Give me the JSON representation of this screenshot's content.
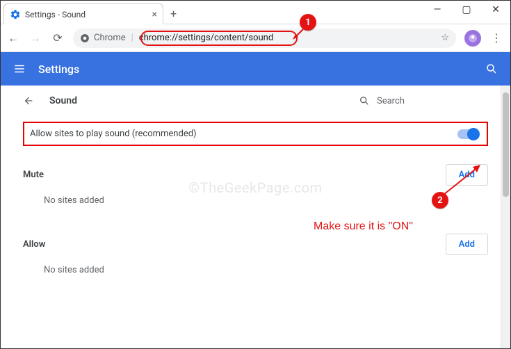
{
  "window": {
    "tab_title": "Settings - Sound",
    "minimize": "—",
    "maximize": "▢",
    "close": "✕",
    "new_tab": "+"
  },
  "addr": {
    "back": "←",
    "forward": "→",
    "reload": "⟳",
    "chip_label": "Chrome",
    "url": "chrome://settings/content/sound",
    "star": "☆",
    "menu": "⋮"
  },
  "bluebar": {
    "title": "Settings"
  },
  "page": {
    "back_arrow": "←",
    "title": "Sound",
    "search_placeholder": "Search",
    "allow_label": "Allow sites to play sound (recommended)",
    "toggle_on": true,
    "sections": {
      "mute": {
        "title": "Mute",
        "add": "Add",
        "empty": "No sites added"
      },
      "allow": {
        "title": "Allow",
        "add": "Add",
        "empty": "No sites added"
      }
    }
  },
  "annotations": {
    "circle1": "1",
    "circle2": "2",
    "caption": "Make sure it is \"ON\"",
    "watermark": "©TheGeekPage.com"
  }
}
